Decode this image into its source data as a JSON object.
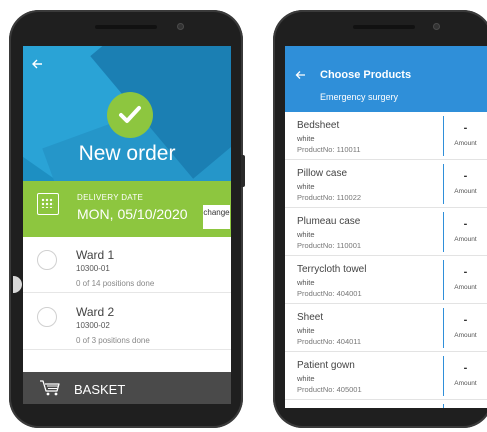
{
  "left_screen": {
    "hero": {
      "title": "New order",
      "back_icon": "arrow-left-icon",
      "status_icon": "check-icon"
    },
    "delivery": {
      "label": "DELIVERY DATE",
      "date": "MON, 05/10/2020",
      "change_label": "change",
      "icon": "calendar-icon"
    },
    "wards": [
      {
        "name": "Ward 1",
        "code": "10300-01",
        "progress": "0 of 14 positions done"
      },
      {
        "name": "Ward 2",
        "code": "10300-02",
        "progress": "0 of 3 positions done"
      }
    ],
    "basket": {
      "label": "BASKET",
      "icon": "cart-icon"
    }
  },
  "right_screen": {
    "header": {
      "title": "Choose Products",
      "subtitle": "Emergency surgery",
      "back_icon": "arrow-left-icon"
    },
    "products": [
      {
        "name": "Bedsheet",
        "color": "white",
        "product_no": "ProductNo: 110011",
        "amount": "-",
        "amount_label": "Amount"
      },
      {
        "name": "Pillow case",
        "color": "white",
        "product_no": "ProductNo: 110022",
        "amount": "-",
        "amount_label": "Amount"
      },
      {
        "name": "Plumeau case",
        "color": "white",
        "product_no": "ProductNo: 110001",
        "amount": "-",
        "amount_label": "Amount"
      },
      {
        "name": "Terrycloth  towel",
        "color": "white",
        "product_no": "ProductNo: 404001",
        "amount": "-",
        "amount_label": "Amount"
      },
      {
        "name": "Sheet",
        "color": "white",
        "product_no": "ProductNo: 404011",
        "amount": "-",
        "amount_label": "Amount"
      },
      {
        "name": "Patient gown",
        "color": "white",
        "product_no": "ProductNo: 405001",
        "amount": "-",
        "amount_label": "Amount"
      }
    ]
  },
  "colors": {
    "accent_green": "#8dc63f",
    "accent_blue": "#2f8fd9",
    "basket_bar": "#4a4a4a"
  }
}
